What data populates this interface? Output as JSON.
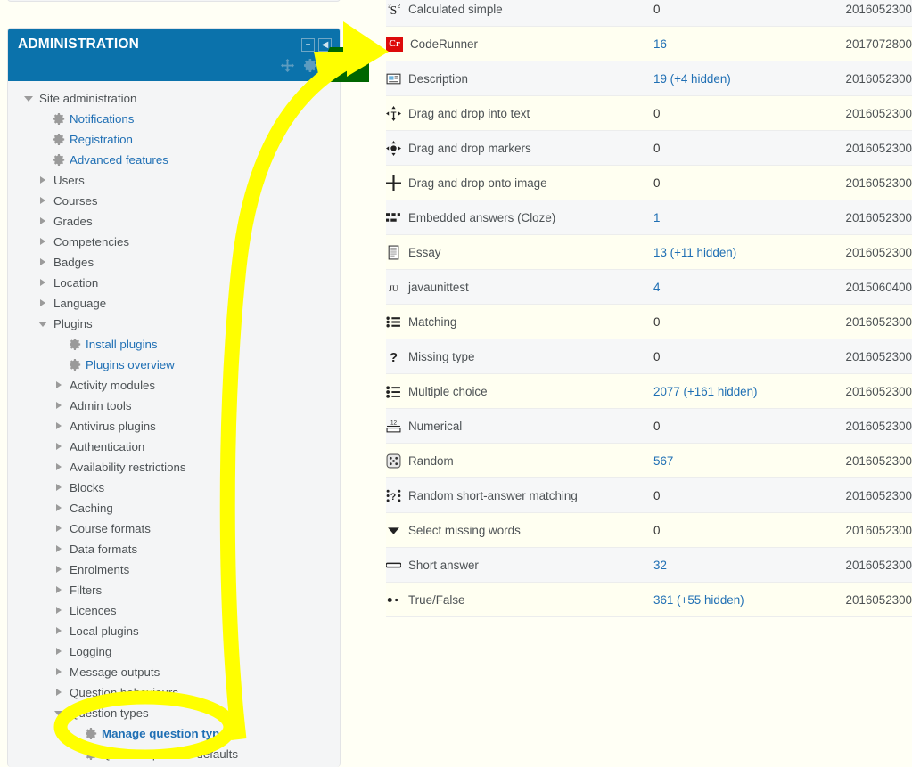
{
  "block": {
    "title": "ADMINISTRATION",
    "minimize_label": "−",
    "dock_label": "◀",
    "move_icon": "move-icon",
    "gear_icon": "gear-icon"
  },
  "sidebar": {
    "items": [
      {
        "label": "Site administration",
        "level": 0,
        "twisty": "open",
        "icon": "none",
        "style": "plain"
      },
      {
        "label": "Notifications",
        "level": 1,
        "twisty": "none",
        "icon": "gear",
        "style": "link"
      },
      {
        "label": "Registration",
        "level": 1,
        "twisty": "none",
        "icon": "gear",
        "style": "link"
      },
      {
        "label": "Advanced features",
        "level": 1,
        "twisty": "none",
        "icon": "gear",
        "style": "link"
      },
      {
        "label": "Users",
        "level": 1,
        "twisty": "closed",
        "icon": "none",
        "style": "plain"
      },
      {
        "label": "Courses",
        "level": 1,
        "twisty": "closed",
        "icon": "none",
        "style": "plain"
      },
      {
        "label": "Grades",
        "level": 1,
        "twisty": "closed",
        "icon": "none",
        "style": "plain"
      },
      {
        "label": "Competencies",
        "level": 1,
        "twisty": "closed",
        "icon": "none",
        "style": "plain"
      },
      {
        "label": "Badges",
        "level": 1,
        "twisty": "closed",
        "icon": "none",
        "style": "plain"
      },
      {
        "label": "Location",
        "level": 1,
        "twisty": "closed",
        "icon": "none",
        "style": "plain"
      },
      {
        "label": "Language",
        "level": 1,
        "twisty": "closed",
        "icon": "none",
        "style": "plain"
      },
      {
        "label": "Plugins",
        "level": 1,
        "twisty": "open",
        "icon": "none",
        "style": "plain"
      },
      {
        "label": "Install plugins",
        "level": 2,
        "twisty": "none",
        "icon": "gear",
        "style": "link"
      },
      {
        "label": "Plugins overview",
        "level": 2,
        "twisty": "none",
        "icon": "gear",
        "style": "link"
      },
      {
        "label": "Activity modules",
        "level": 2,
        "twisty": "closed",
        "icon": "none",
        "style": "plain"
      },
      {
        "label": "Admin tools",
        "level": 2,
        "twisty": "closed",
        "icon": "none",
        "style": "plain"
      },
      {
        "label": "Antivirus plugins",
        "level": 2,
        "twisty": "closed",
        "icon": "none",
        "style": "plain"
      },
      {
        "label": "Authentication",
        "level": 2,
        "twisty": "closed",
        "icon": "none",
        "style": "plain"
      },
      {
        "label": "Availability restrictions",
        "level": 2,
        "twisty": "closed",
        "icon": "none",
        "style": "plain"
      },
      {
        "label": "Blocks",
        "level": 2,
        "twisty": "closed",
        "icon": "none",
        "style": "plain"
      },
      {
        "label": "Caching",
        "level": 2,
        "twisty": "closed",
        "icon": "none",
        "style": "plain"
      },
      {
        "label": "Course formats",
        "level": 2,
        "twisty": "closed",
        "icon": "none",
        "style": "plain"
      },
      {
        "label": "Data formats",
        "level": 2,
        "twisty": "closed",
        "icon": "none",
        "style": "plain"
      },
      {
        "label": "Enrolments",
        "level": 2,
        "twisty": "closed",
        "icon": "none",
        "style": "plain"
      },
      {
        "label": "Filters",
        "level": 2,
        "twisty": "closed",
        "icon": "none",
        "style": "plain"
      },
      {
        "label": "Licences",
        "level": 2,
        "twisty": "closed",
        "icon": "none",
        "style": "plain"
      },
      {
        "label": "Local plugins",
        "level": 2,
        "twisty": "closed",
        "icon": "none",
        "style": "plain"
      },
      {
        "label": "Logging",
        "level": 2,
        "twisty": "closed",
        "icon": "none",
        "style": "plain"
      },
      {
        "label": "Message outputs",
        "level": 2,
        "twisty": "closed",
        "icon": "none",
        "style": "plain"
      },
      {
        "label": "Question behaviours",
        "level": 2,
        "twisty": "closed",
        "icon": "none",
        "style": "plain"
      },
      {
        "label": "Question types",
        "level": 2,
        "twisty": "open",
        "icon": "none",
        "style": "plain"
      },
      {
        "label": "Manage question types",
        "level": 3,
        "twisty": "none",
        "icon": "gear",
        "style": "highlight"
      },
      {
        "label": "Question preview defaults",
        "level": 3,
        "twisty": "none",
        "icon": "gear",
        "style": "plain"
      }
    ]
  },
  "table": {
    "rows": [
      {
        "name": "Calculated simple",
        "icon": "calculated-simple-icon",
        "count": "0",
        "count_link": false,
        "version": "2016052300"
      },
      {
        "name": "CodeRunner",
        "icon": "coderunner-icon",
        "count": "16",
        "count_link": true,
        "version": "2017072800"
      },
      {
        "name": "Description",
        "icon": "description-icon",
        "count": "19 (+4 hidden)",
        "count_link": true,
        "version": "2016052300"
      },
      {
        "name": "Drag and drop into text",
        "icon": "ddwtos-icon",
        "count": "0",
        "count_link": false,
        "version": "2016052300"
      },
      {
        "name": "Drag and drop markers",
        "icon": "ddmarker-icon",
        "count": "0",
        "count_link": false,
        "version": "2016052300"
      },
      {
        "name": "Drag and drop onto image",
        "icon": "ddimageortext-icon",
        "count": "0",
        "count_link": false,
        "version": "2016052300"
      },
      {
        "name": "Embedded answers (Cloze)",
        "icon": "multianswer-icon",
        "count": "1",
        "count_link": true,
        "version": "2016052300"
      },
      {
        "name": "Essay",
        "icon": "essay-icon",
        "count": "13 (+11 hidden)",
        "count_link": true,
        "version": "2016052300"
      },
      {
        "name": "javaunittest",
        "icon": "javaunittest-icon",
        "count": "4",
        "count_link": true,
        "version": "2015060400"
      },
      {
        "name": "Matching",
        "icon": "match-icon",
        "count": "0",
        "count_link": false,
        "version": "2016052300"
      },
      {
        "name": "Missing type",
        "icon": "missingtype-icon",
        "count": "0",
        "count_link": false,
        "version": "2016052300"
      },
      {
        "name": "Multiple choice",
        "icon": "multichoice-icon",
        "count": "2077 (+161 hidden)",
        "count_link": true,
        "version": "2016052300"
      },
      {
        "name": "Numerical",
        "icon": "numerical-icon",
        "count": "0",
        "count_link": false,
        "version": "2016052300"
      },
      {
        "name": "Random",
        "icon": "random-icon",
        "count": "567",
        "count_link": true,
        "version": "2016052300"
      },
      {
        "name": "Random short-answer matching",
        "icon": "randomsamatch-icon",
        "count": "0",
        "count_link": false,
        "version": "2016052300"
      },
      {
        "name": "Select missing words",
        "icon": "gapselect-icon",
        "count": "0",
        "count_link": false,
        "version": "2016052300"
      },
      {
        "name": "Short answer",
        "icon": "shortanswer-icon",
        "count": "32",
        "count_link": true,
        "version": "2016052300"
      },
      {
        "name": "True/False",
        "icon": "truefalse-icon",
        "count": "361 (+55 hidden)",
        "count_link": true,
        "version": "2016052300"
      }
    ]
  },
  "annotations": {
    "arrow": {
      "name": "yellow-arrow-annotation",
      "color": "#ffff00",
      "shadow_color": "#006600"
    },
    "ellipse": {
      "name": "yellow-ellipse-annotation",
      "color": "#ffff00",
      "target": "Manage question types"
    }
  },
  "colors": {
    "block_header": "#0b72ab",
    "link": "#1f6fb4",
    "page_background": "#fffff5",
    "row_odd": "#f6f7f8",
    "row_even": "#fffff1",
    "coderunner_badge": "#dd0a0a"
  }
}
